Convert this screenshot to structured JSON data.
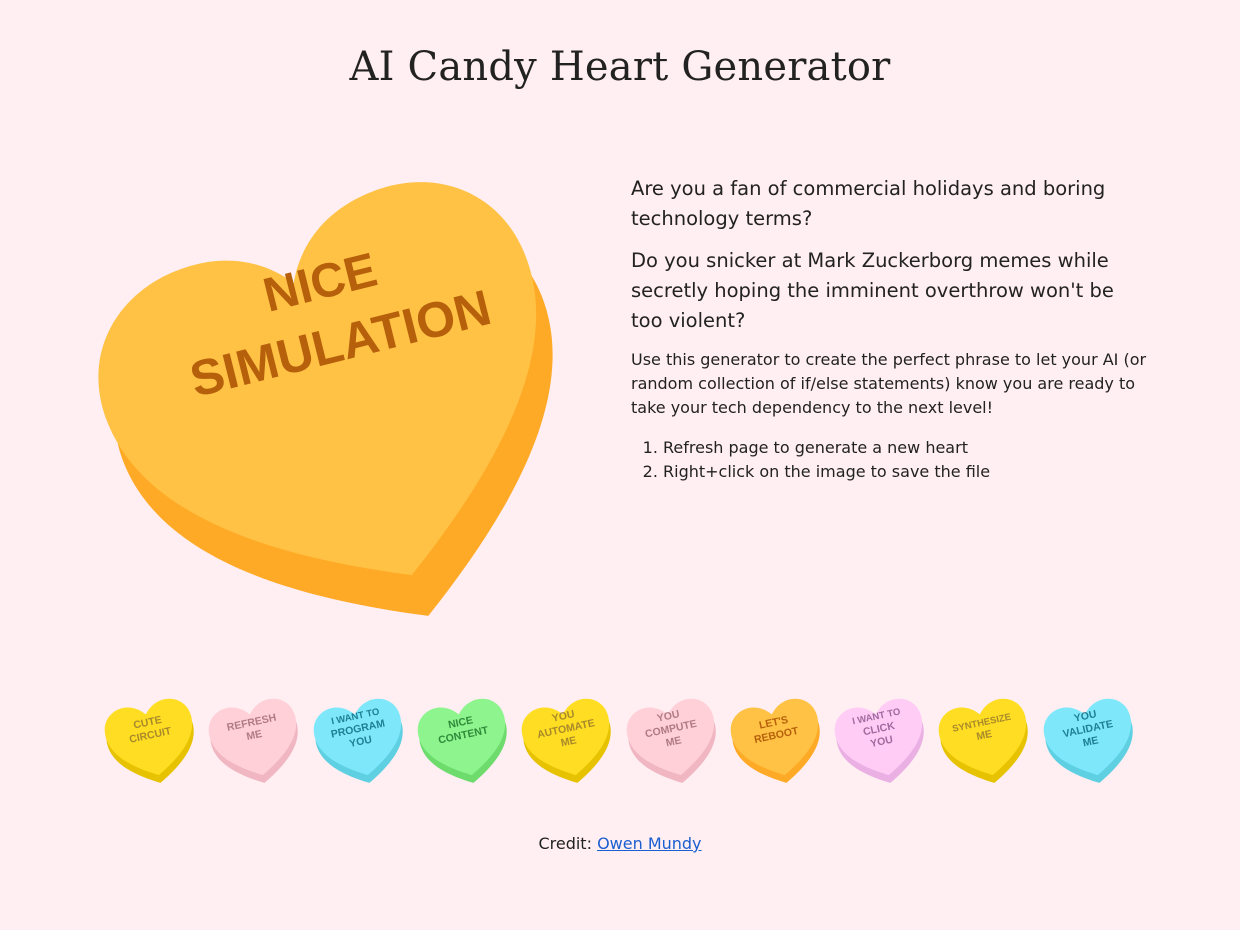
{
  "page": {
    "title": "AI Candy Heart Generator",
    "background": "#ffeef2"
  },
  "main_heart": {
    "line1": "NICE",
    "line2": "SIMULATION",
    "top_color": "#ffc244",
    "side_color": "#ffaa26",
    "text_color": "#b6600c"
  },
  "intro": {
    "p1": "Are you a fan of commercial holidays and boring technology terms?",
    "p2": "Do you snicker at Mark Zuckerborg memes while secretly hoping the imminent overthrow won't be too violent?",
    "p3": "Use this generator to create the perfect phrase to let your AI (or random collection of if/else statements) know you are ready to take your tech dependency to the next level!",
    "steps": [
      "Refresh page to generate a new heart",
      "Right+click on the image to save the file"
    ]
  },
  "mini_hearts": [
    {
      "lines": [
        "CUTE",
        "CIRCUIT"
      ],
      "top": "#ffdd22",
      "side": "#e6c200",
      "text": "#a88a2a"
    },
    {
      "lines": [
        "REFRESH",
        "ME"
      ],
      "top": "#ffd0d8",
      "side": "#f0b6c2",
      "text": "#b07a86"
    },
    {
      "lines": [
        "I WANT TO",
        "PROGRAM",
        "YOU"
      ],
      "top": "#7ee8fa",
      "side": "#5ed0e2",
      "text": "#1f7f95"
    },
    {
      "lines": [
        "NICE",
        "CONTENT"
      ],
      "top": "#8ef58e",
      "side": "#6ddc6d",
      "text": "#2f8a3a"
    },
    {
      "lines": [
        "YOU",
        "AUTOMATE",
        "ME"
      ],
      "top": "#ffdd22",
      "side": "#e6c200",
      "text": "#a88a2a"
    },
    {
      "lines": [
        "YOU",
        "COMPUTE",
        "ME"
      ],
      "top": "#ffd0d8",
      "side": "#f0b6c2",
      "text": "#b07a86"
    },
    {
      "lines": [
        "LET'S",
        "REBOOT"
      ],
      "top": "#ffc244",
      "side": "#ffaa26",
      "text": "#b6600c"
    },
    {
      "lines": [
        "I WANT TO",
        "CLICK",
        "YOU"
      ],
      "top": "#ffccf6",
      "side": "#eab0e4",
      "text": "#a06a9e"
    },
    {
      "lines": [
        "SYNTHESIZE",
        "ME"
      ],
      "top": "#ffdd22",
      "side": "#e6c200",
      "text": "#a88a2a"
    },
    {
      "lines": [
        "YOU",
        "VALIDATE",
        "ME"
      ],
      "top": "#7ee8fa",
      "side": "#5ed0e2",
      "text": "#1f7f95"
    }
  ],
  "credit": {
    "label": "Credit:",
    "link_text": "Owen Mundy"
  }
}
